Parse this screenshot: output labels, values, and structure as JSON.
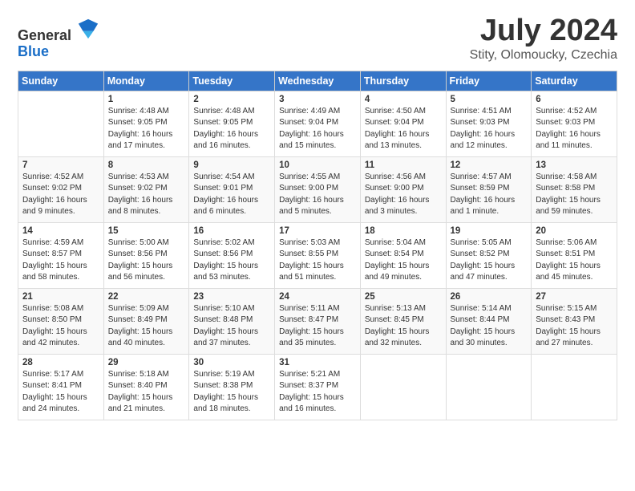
{
  "header": {
    "logo_general": "General",
    "logo_blue": "Blue",
    "title": "July 2024",
    "location": "Stity, Olomoucky, Czechia"
  },
  "columns": [
    "Sunday",
    "Monday",
    "Tuesday",
    "Wednesday",
    "Thursday",
    "Friday",
    "Saturday"
  ],
  "weeks": [
    [
      {
        "day": "",
        "info": ""
      },
      {
        "day": "1",
        "info": "Sunrise: 4:48 AM\nSunset: 9:05 PM\nDaylight: 16 hours\nand 17 minutes."
      },
      {
        "day": "2",
        "info": "Sunrise: 4:48 AM\nSunset: 9:05 PM\nDaylight: 16 hours\nand 16 minutes."
      },
      {
        "day": "3",
        "info": "Sunrise: 4:49 AM\nSunset: 9:04 PM\nDaylight: 16 hours\nand 15 minutes."
      },
      {
        "day": "4",
        "info": "Sunrise: 4:50 AM\nSunset: 9:04 PM\nDaylight: 16 hours\nand 13 minutes."
      },
      {
        "day": "5",
        "info": "Sunrise: 4:51 AM\nSunset: 9:03 PM\nDaylight: 16 hours\nand 12 minutes."
      },
      {
        "day": "6",
        "info": "Sunrise: 4:52 AM\nSunset: 9:03 PM\nDaylight: 16 hours\nand 11 minutes."
      }
    ],
    [
      {
        "day": "7",
        "info": "Sunrise: 4:52 AM\nSunset: 9:02 PM\nDaylight: 16 hours\nand 9 minutes."
      },
      {
        "day": "8",
        "info": "Sunrise: 4:53 AM\nSunset: 9:02 PM\nDaylight: 16 hours\nand 8 minutes."
      },
      {
        "day": "9",
        "info": "Sunrise: 4:54 AM\nSunset: 9:01 PM\nDaylight: 16 hours\nand 6 minutes."
      },
      {
        "day": "10",
        "info": "Sunrise: 4:55 AM\nSunset: 9:00 PM\nDaylight: 16 hours\nand 5 minutes."
      },
      {
        "day": "11",
        "info": "Sunrise: 4:56 AM\nSunset: 9:00 PM\nDaylight: 16 hours\nand 3 minutes."
      },
      {
        "day": "12",
        "info": "Sunrise: 4:57 AM\nSunset: 8:59 PM\nDaylight: 16 hours\nand 1 minute."
      },
      {
        "day": "13",
        "info": "Sunrise: 4:58 AM\nSunset: 8:58 PM\nDaylight: 15 hours\nand 59 minutes."
      }
    ],
    [
      {
        "day": "14",
        "info": "Sunrise: 4:59 AM\nSunset: 8:57 PM\nDaylight: 15 hours\nand 58 minutes."
      },
      {
        "day": "15",
        "info": "Sunrise: 5:00 AM\nSunset: 8:56 PM\nDaylight: 15 hours\nand 56 minutes."
      },
      {
        "day": "16",
        "info": "Sunrise: 5:02 AM\nSunset: 8:56 PM\nDaylight: 15 hours\nand 53 minutes."
      },
      {
        "day": "17",
        "info": "Sunrise: 5:03 AM\nSunset: 8:55 PM\nDaylight: 15 hours\nand 51 minutes."
      },
      {
        "day": "18",
        "info": "Sunrise: 5:04 AM\nSunset: 8:54 PM\nDaylight: 15 hours\nand 49 minutes."
      },
      {
        "day": "19",
        "info": "Sunrise: 5:05 AM\nSunset: 8:52 PM\nDaylight: 15 hours\nand 47 minutes."
      },
      {
        "day": "20",
        "info": "Sunrise: 5:06 AM\nSunset: 8:51 PM\nDaylight: 15 hours\nand 45 minutes."
      }
    ],
    [
      {
        "day": "21",
        "info": "Sunrise: 5:08 AM\nSunset: 8:50 PM\nDaylight: 15 hours\nand 42 minutes."
      },
      {
        "day": "22",
        "info": "Sunrise: 5:09 AM\nSunset: 8:49 PM\nDaylight: 15 hours\nand 40 minutes."
      },
      {
        "day": "23",
        "info": "Sunrise: 5:10 AM\nSunset: 8:48 PM\nDaylight: 15 hours\nand 37 minutes."
      },
      {
        "day": "24",
        "info": "Sunrise: 5:11 AM\nSunset: 8:47 PM\nDaylight: 15 hours\nand 35 minutes."
      },
      {
        "day": "25",
        "info": "Sunrise: 5:13 AM\nSunset: 8:45 PM\nDaylight: 15 hours\nand 32 minutes."
      },
      {
        "day": "26",
        "info": "Sunrise: 5:14 AM\nSunset: 8:44 PM\nDaylight: 15 hours\nand 30 minutes."
      },
      {
        "day": "27",
        "info": "Sunrise: 5:15 AM\nSunset: 8:43 PM\nDaylight: 15 hours\nand 27 minutes."
      }
    ],
    [
      {
        "day": "28",
        "info": "Sunrise: 5:17 AM\nSunset: 8:41 PM\nDaylight: 15 hours\nand 24 minutes."
      },
      {
        "day": "29",
        "info": "Sunrise: 5:18 AM\nSunset: 8:40 PM\nDaylight: 15 hours\nand 21 minutes."
      },
      {
        "day": "30",
        "info": "Sunrise: 5:19 AM\nSunset: 8:38 PM\nDaylight: 15 hours\nand 18 minutes."
      },
      {
        "day": "31",
        "info": "Sunrise: 5:21 AM\nSunset: 8:37 PM\nDaylight: 15 hours\nand 16 minutes."
      },
      {
        "day": "",
        "info": ""
      },
      {
        "day": "",
        "info": ""
      },
      {
        "day": "",
        "info": ""
      }
    ]
  ]
}
